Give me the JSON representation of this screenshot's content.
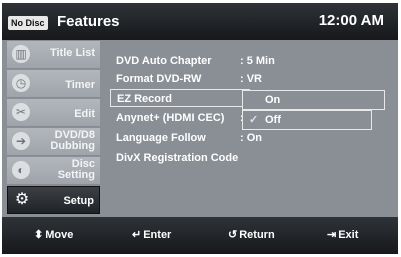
{
  "header": {
    "disc_status": "No Disc",
    "title": "Features",
    "clock": "12:00 AM"
  },
  "sidebar": {
    "items": [
      {
        "label": "Title List",
        "icon": "title-list-icon",
        "glyph": "▥",
        "active": false
      },
      {
        "label": "Timer",
        "icon": "timer-icon",
        "glyph": "◷",
        "active": false
      },
      {
        "label": "Edit",
        "icon": "edit-scissors-icon",
        "glyph": "✂",
        "active": false
      },
      {
        "label": "DVD/D8",
        "label2": "Dubbing",
        "icon": "dubbing-icon",
        "glyph": "➔",
        "active": false
      },
      {
        "label": "Disc",
        "label2": "Setting",
        "icon": "disc-setting-icon",
        "glyph": "◐",
        "active": false
      },
      {
        "label": "Setup",
        "icon": "gear-icon",
        "glyph": "⚙",
        "active": true
      }
    ]
  },
  "menu": {
    "rows": [
      {
        "label": "DVD Auto Chapter",
        "value": ": 5 Min"
      },
      {
        "label": "Format DVD-RW",
        "value": ": VR"
      },
      {
        "label": "EZ Record",
        "value": ":"
      },
      {
        "label": "Anynet+ (HDMI CEC)",
        "value": ":"
      },
      {
        "label": "Language Follow",
        "value": ": On"
      },
      {
        "label": "DivX Registration Code",
        "value": ""
      }
    ]
  },
  "popup": {
    "options": [
      {
        "label": "On",
        "selected": false
      },
      {
        "label": "Off",
        "selected": true,
        "check": "✓"
      }
    ]
  },
  "footer": {
    "move": {
      "icon": "up-down-arrows-icon",
      "glyph": "⬍",
      "label": "Move"
    },
    "enter": {
      "icon": "enter-icon",
      "glyph": "↵",
      "label": "Enter"
    },
    "return": {
      "icon": "return-icon",
      "glyph": "↺",
      "label": "Return"
    },
    "exit": {
      "icon": "exit-icon",
      "glyph": "⇥",
      "label": "Exit"
    }
  },
  "colors": {
    "background": "#8a8f96",
    "bar": "#1e2124",
    "text": "#ffffff"
  }
}
